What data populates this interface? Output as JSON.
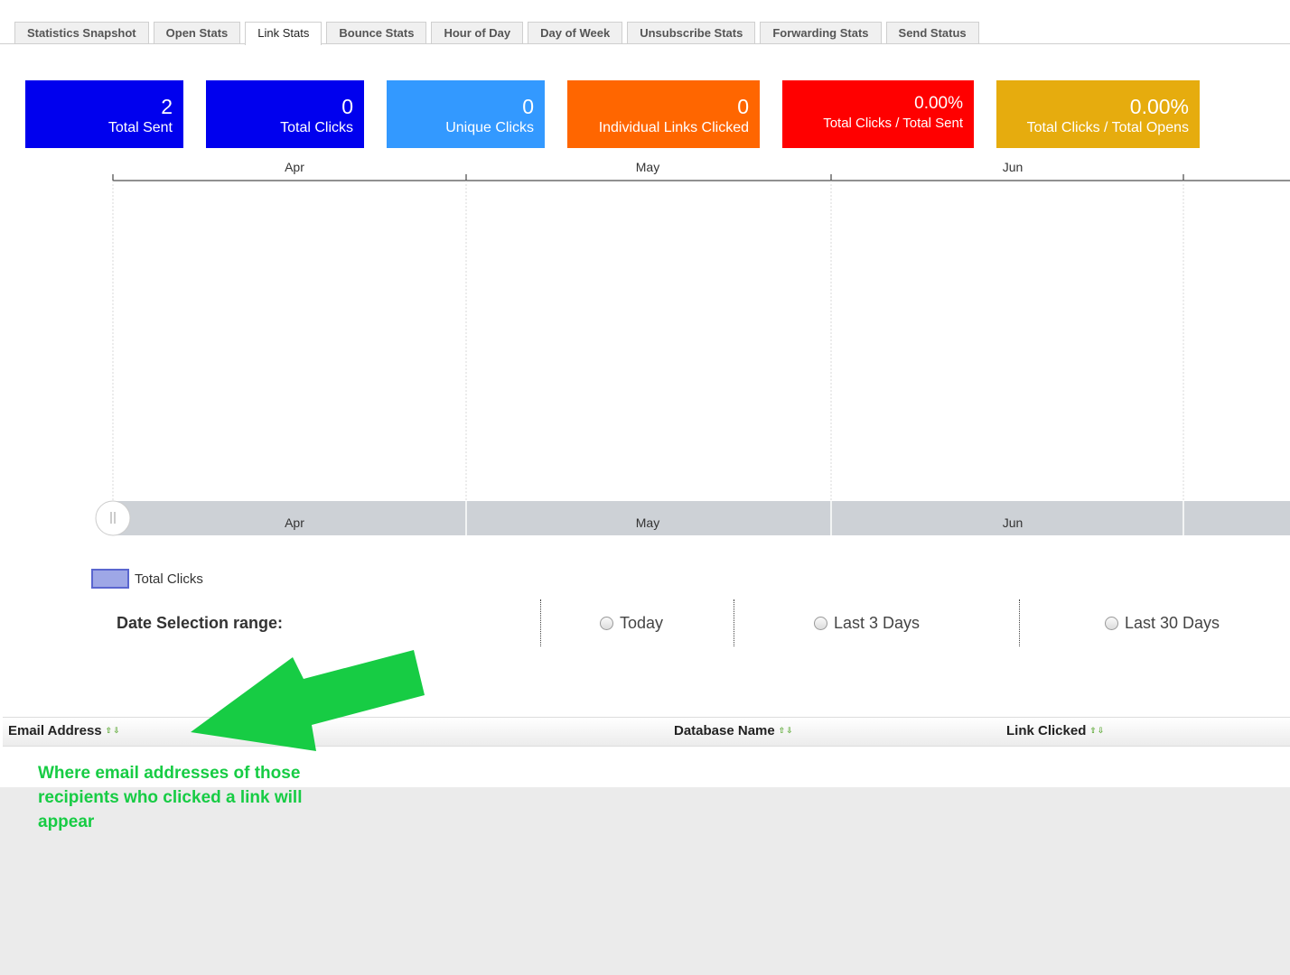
{
  "tabs": [
    {
      "label": "Statistics Snapshot",
      "active": false
    },
    {
      "label": "Open Stats",
      "active": false
    },
    {
      "label": "Link Stats",
      "active": true
    },
    {
      "label": "Bounce Stats",
      "active": false
    },
    {
      "label": "Hour of Day",
      "active": false
    },
    {
      "label": "Day of Week",
      "active": false
    },
    {
      "label": "Unsubscribe Stats",
      "active": false
    },
    {
      "label": "Forwarding Stats",
      "active": false
    },
    {
      "label": "Send Status",
      "active": false
    }
  ],
  "cards": [
    {
      "value": "2",
      "label": "Total Sent",
      "color": "#0000ee"
    },
    {
      "value": "0",
      "label": "Total Clicks",
      "color": "#0000ee"
    },
    {
      "value": "0",
      "label": "Unique Clicks",
      "color": "#3399ff"
    },
    {
      "value": "0",
      "label": "Individual Links Clicked",
      "color": "#ff6600"
    },
    {
      "value": "0.00%",
      "label": "Total Clicks / Total Sent",
      "color": "#ff0000"
    },
    {
      "value": "0.00%",
      "label": "Total Clicks / Total Opens",
      "color": "#e6ac0e"
    }
  ],
  "chart_data": {
    "type": "area",
    "categories": [
      "Apr",
      "May",
      "Jun"
    ],
    "series": [
      {
        "name": "Total Clicks",
        "values": []
      }
    ],
    "navigator_labels": [
      "Apr",
      "May",
      "Jun"
    ],
    "legend": "bottom-left",
    "grid": true
  },
  "legend": {
    "label": "Total Clicks"
  },
  "date_range": {
    "title": "Date Selection range:",
    "options": [
      "Today",
      "Last 3 Days",
      "Last 30 Days"
    ]
  },
  "table": {
    "columns": [
      "Email Address",
      "Database Name",
      "Link Clicked"
    ],
    "sort_glyph": "⇧⇩"
  },
  "annotation": {
    "text": "Where email addresses of those recipients who clicked a link will appear",
    "color": "#17cc44"
  }
}
